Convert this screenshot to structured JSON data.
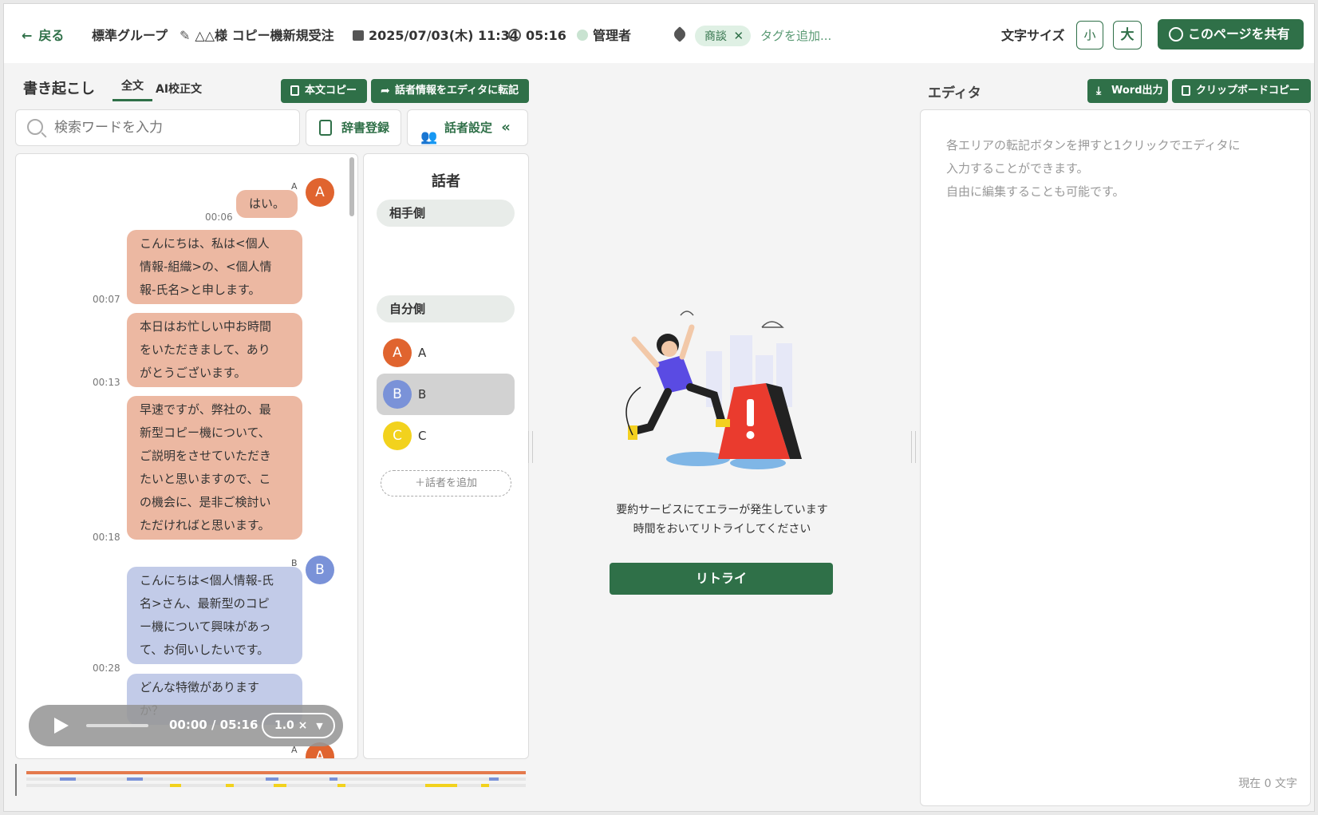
{
  "header": {
    "back_label": "戻る",
    "group": "標準グループ",
    "title": "△△様 コピー機新規受注",
    "datetime": "2025/07/03(木) 11:34",
    "duration": "05:16",
    "owner": "管理者",
    "tag_label": "商談",
    "add_tag_label": "タグを追加...",
    "font_size_label": "文字サイズ",
    "font_small_label": "小",
    "font_large_label": "大",
    "share_label": "このページを共有"
  },
  "transcript": {
    "title": "書き起こし",
    "tab_full": "全文",
    "tab_ai": "AI校正文",
    "copy_label": "本文コピー",
    "transfer_label": "話者情報をエディタに転記",
    "search_placeholder": "検索ワードを入力",
    "dict_label": "辞書登録",
    "speaker_settings_label": "話者設定",
    "messages": [
      {
        "speaker": "A",
        "time": "00:06",
        "text": "はい。"
      },
      {
        "speaker": "A",
        "time": "00:07",
        "lines": [
          "こんにちは、私は<個人",
          "情報-組織>の、<個人情",
          "報-氏名>と申します。"
        ]
      },
      {
        "speaker": "A",
        "time": "00:13",
        "lines": [
          "本日はお忙しい中お時間",
          "をいただきまして、あり",
          "がとうございます。"
        ]
      },
      {
        "speaker": "A",
        "time": "00:18",
        "lines": [
          "早速ですが、弊社の、最",
          "新型コピー機について、",
          "ご説明をさせていただき",
          "たいと思いますので、こ",
          "の機会に、是非ご検討い",
          "ただければと思います。"
        ]
      },
      {
        "speaker": "B",
        "time": "00:28",
        "lines": [
          "こんにちは<個人情報-氏",
          "名>さん、最新型のコピ",
          "ー機について興味があっ",
          "て、お伺いしたいです。"
        ]
      },
      {
        "speaker": "B",
        "time": "",
        "lines": [
          "どんな特徴があります",
          "か？"
        ]
      }
    ],
    "next_speaker": "A"
  },
  "player": {
    "time": "00:00 / 05:16",
    "speed": "1.0 ×"
  },
  "speakers": {
    "title": "話者",
    "other_side": "相手側",
    "self_side": "自分側",
    "list": [
      {
        "initial": "A",
        "name": "A"
      },
      {
        "initial": "B",
        "name": "B"
      },
      {
        "initial": "C",
        "name": "C"
      }
    ],
    "add_label": "＋話者を追加"
  },
  "summary": {
    "error_line1": "要約サービスにてエラーが発生しています",
    "error_line2": "時間をおいてリトライしてください",
    "retry_label": "リトライ"
  },
  "editor": {
    "title": "エディタ",
    "word_label": "Word出力",
    "clipboard_label": "クリップボードコピー",
    "hint_lines": [
      "各エリアの転記ボタンを押すと1クリックでエディタに",
      "入力することができます。",
      "自由に編集することも可能です。"
    ],
    "char_count": "現在 0 文字"
  },
  "colors": {
    "accent": "#2f7048",
    "speaker_a": "#e0642f",
    "speaker_b": "#7a92d8",
    "speaker_c": "#f2d21d"
  }
}
